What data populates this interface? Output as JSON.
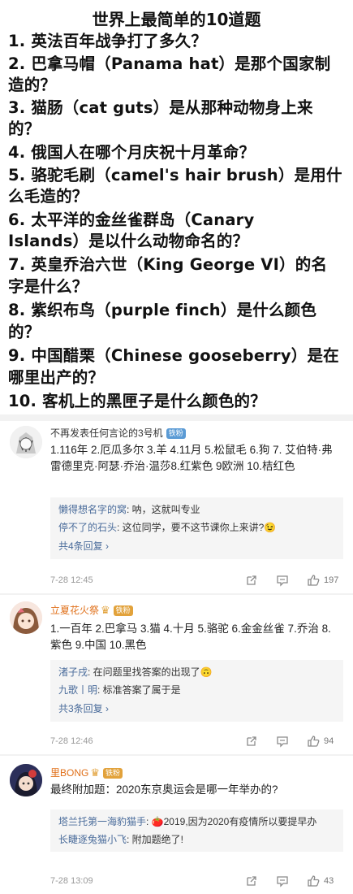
{
  "quiz": {
    "title": "世界上最简单的10道题",
    "lines": [
      "1. 英法百年战争打了多久？",
      "2. 巴拿马帽（Panama hat）是那个国家制",
      "造的？",
      "3. 猫肠（cat guts）是从那种动物身上来",
      "的？",
      "4. 俄国人在哪个月庆祝十月革命？",
      "5. 骆驼毛刷（camel's hair brush）是用什",
      "么毛造的？",
      "6. 太平洋的金丝雀群岛（Canary",
      "Islands）是以什么动物命名的？",
      "7. 英皇乔治六世（King George VI）的名",
      "字是什么？",
      "8. 紫织布鸟（purple finch）是什么颜色",
      "的？",
      "9. 中国醋栗（Chinese gooseberry）是在",
      "哪里出产的？",
      "10. 客机上的黑匣子是什么颜色的？"
    ]
  },
  "comments": [
    {
      "username": "不再发表任何言论的3号机",
      "badge": "铁粉",
      "name_color": "#333333",
      "text": "1.116年 2.厄瓜多尔 3.羊 4.11月 5.松鼠毛 6.狗 7. 艾伯特·弗雷德里克·阿瑟·乔治·温莎8.红紫色 9欧洲  10.桔红色",
      "replies": [
        {
          "name": "懒得想名字的窝",
          "text": ": 呐，这就叫专业"
        },
        {
          "name": "停不了的石头",
          "text": ": 这位同学，要不这节课你上来讲?😉"
        }
      ],
      "more": "共4条回复 ›",
      "time": "7-28 12:45",
      "likes": "197"
    },
    {
      "username": "立夏花火祭",
      "badge": "铁粉",
      "name_color": "#e0701a",
      "text": "1.一百年 2.巴拿马 3.猫 4.十月 5.骆驼 6.金金丝雀 7.乔治 8.紫色 9.中国 10.黑色",
      "replies": [
        {
          "name": "渚子戌",
          "text": ": 在问题里找答案的出现了🙃"
        },
        {
          "name": "九歌丨明",
          "text": ": 标准答案了属于是"
        }
      ],
      "more": "共3条回复 ›",
      "time": "7-28 12:46",
      "likes": "94"
    },
    {
      "username": "里BONG",
      "badge": "铁粉",
      "name_color": "#e0701a",
      "text": "最终附加题：2020东京奥运会是哪一年举办的?",
      "replies": [
        {
          "name": "塔兰托第一海豹猫手",
          "text": ": 🍅2019,因为2020有疫情所以要提早办"
        },
        {
          "name": "长睫逐兔猫小飞",
          "text": ": 附加题绝了!"
        }
      ],
      "time": "7-28 13:09",
      "likes": "43"
    }
  ]
}
